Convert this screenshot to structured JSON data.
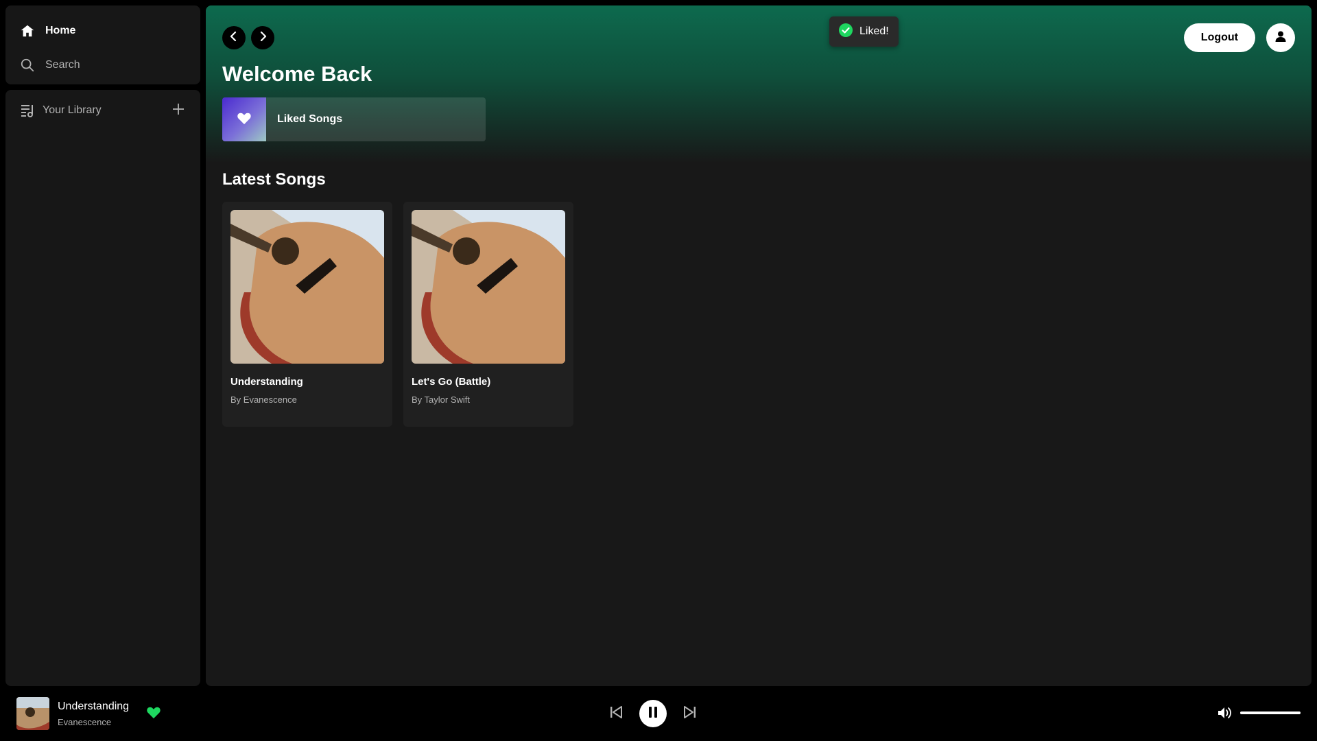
{
  "sidebar": {
    "nav": [
      {
        "label": "Home",
        "icon": "home-icon"
      },
      {
        "label": "Search",
        "icon": "search-icon"
      }
    ],
    "library": {
      "label": "Your Library",
      "icon": "library-icon",
      "add_icon": "plus-icon"
    }
  },
  "topbar": {
    "logout_label": "Logout"
  },
  "toast": {
    "message": "Liked!"
  },
  "main": {
    "welcome": "Welcome Back",
    "liked_songs_label": "Liked Songs",
    "section_title": "Latest Songs",
    "songs": [
      {
        "title": "Understanding",
        "subtitle": "By Evanescence"
      },
      {
        "title": "Let's Go (Battle)",
        "subtitle": "By Taylor Swift"
      }
    ]
  },
  "player": {
    "title": "Understanding",
    "artist": "Evanescence",
    "liked": true,
    "state": "playing"
  },
  "colors": {
    "accent_green": "#1ed760",
    "header_gradient_top": "#0d6a4e"
  }
}
